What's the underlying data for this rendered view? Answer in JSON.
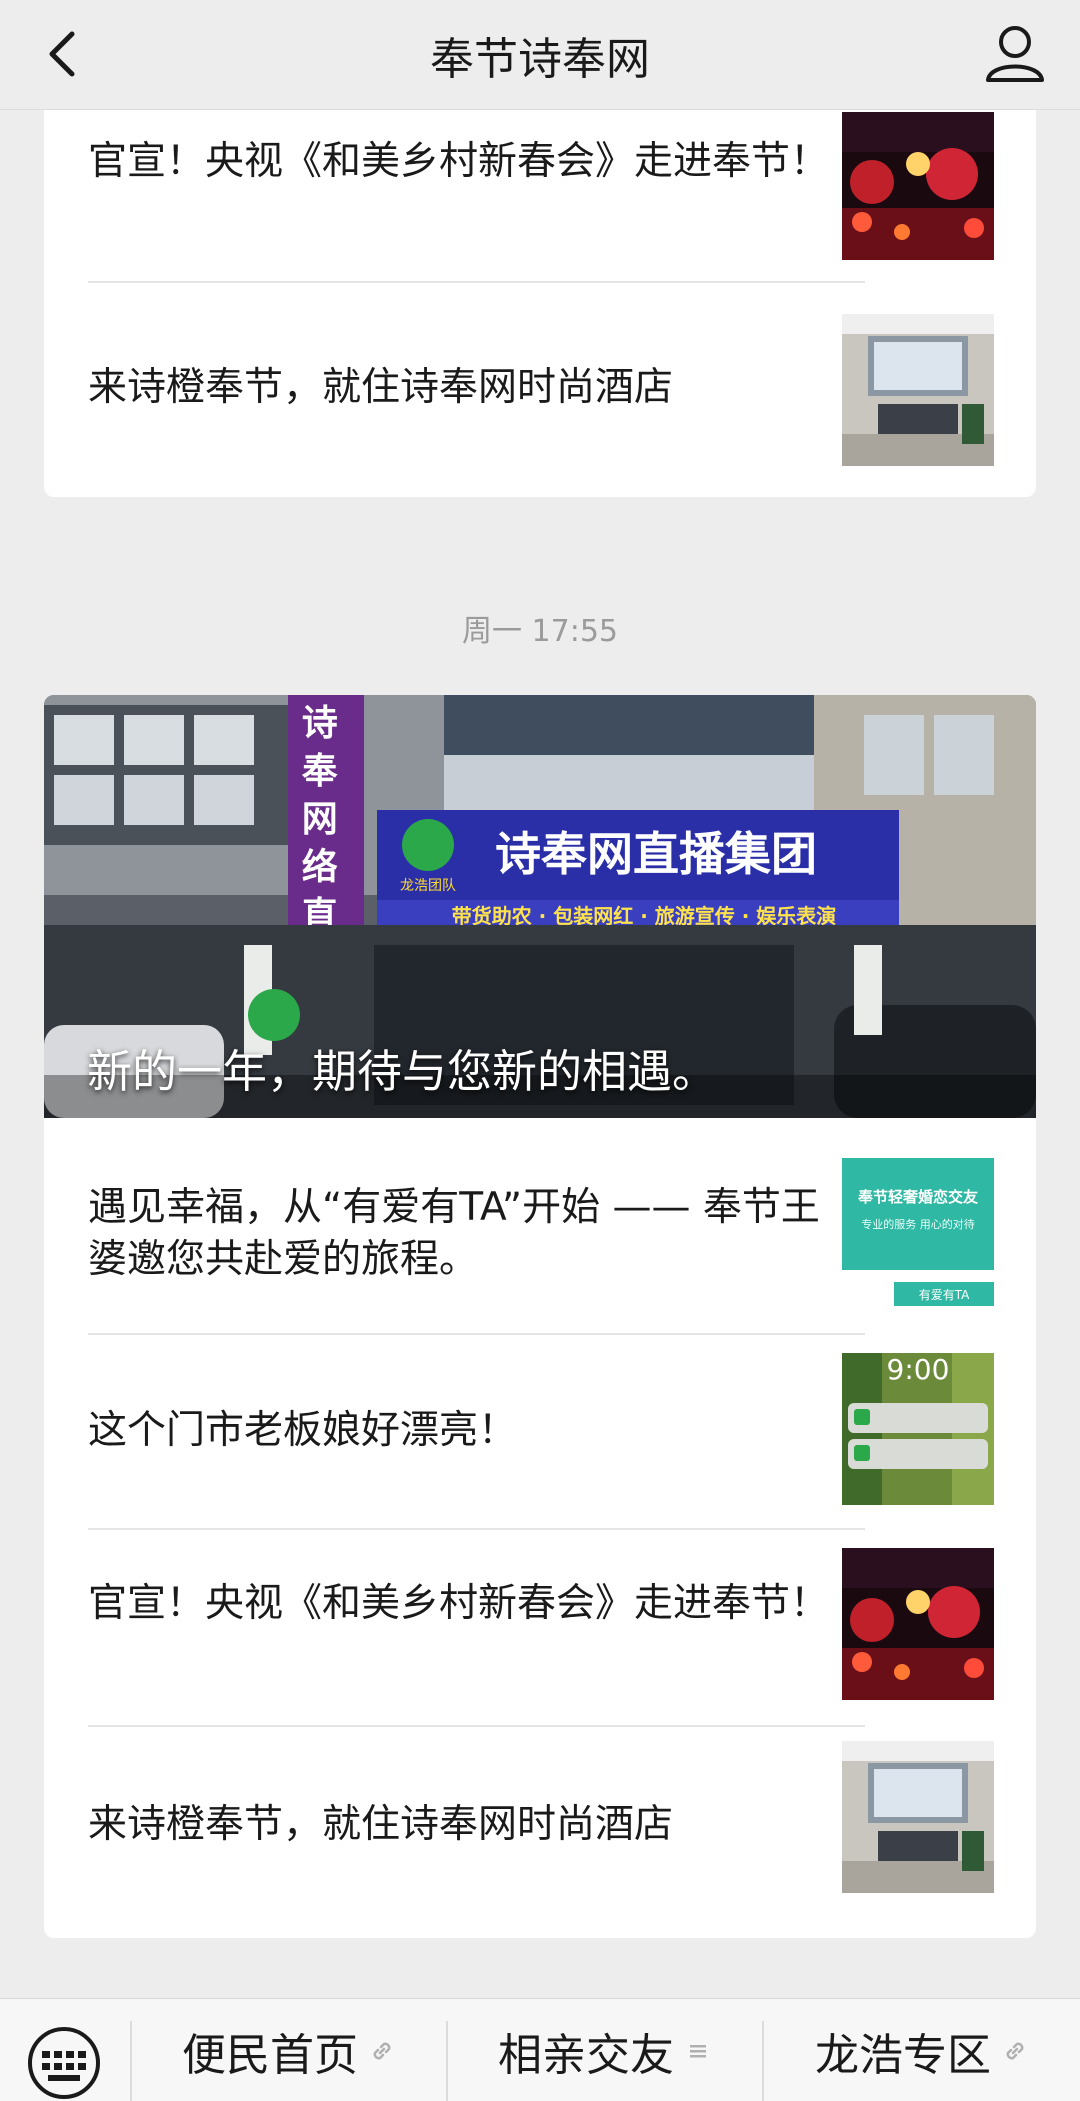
{
  "header": {
    "title": "奉节诗奉网"
  },
  "card1": {
    "items": [
      {
        "title": "官宣！央视《和美乡村新春会》走进奉节！"
      },
      {
        "title": "来诗橙奉节，就住诗奉网时尚酒店"
      }
    ]
  },
  "timestamp": "周一 17:55",
  "card2": {
    "hero": {
      "caption": "新的一年，期待与您新的相遇。",
      "sign_main": "诗奉网直播集团",
      "sign_sub": "带货助农 · 包装网红 · 旅游宣传 · 娱乐表演",
      "sign_vertical": "诗奉网络直播",
      "badge": "龙浩团队"
    },
    "items": [
      {
        "title": "遇见幸福，从“有爱有TA”开始 —— 奉节王婆邀您共赴爱的旅程。",
        "thumb_text": "奉节轻奢婚恋交友",
        "thumb_sub": "专业的服务 用心的对待",
        "thumb_badge": "有爱有TA"
      },
      {
        "title": "这个门市老板娘好漂亮！",
        "thumb_text": "9:00"
      },
      {
        "title": "官宣！央视《和美乡村新春会》走进奉节！"
      },
      {
        "title": "来诗橙奉节，就住诗奉网时尚酒店"
      }
    ]
  },
  "bottom_menu": {
    "items": [
      {
        "label": "便民首页"
      },
      {
        "label": "相亲交友"
      },
      {
        "label": "龙浩专区"
      }
    ]
  }
}
